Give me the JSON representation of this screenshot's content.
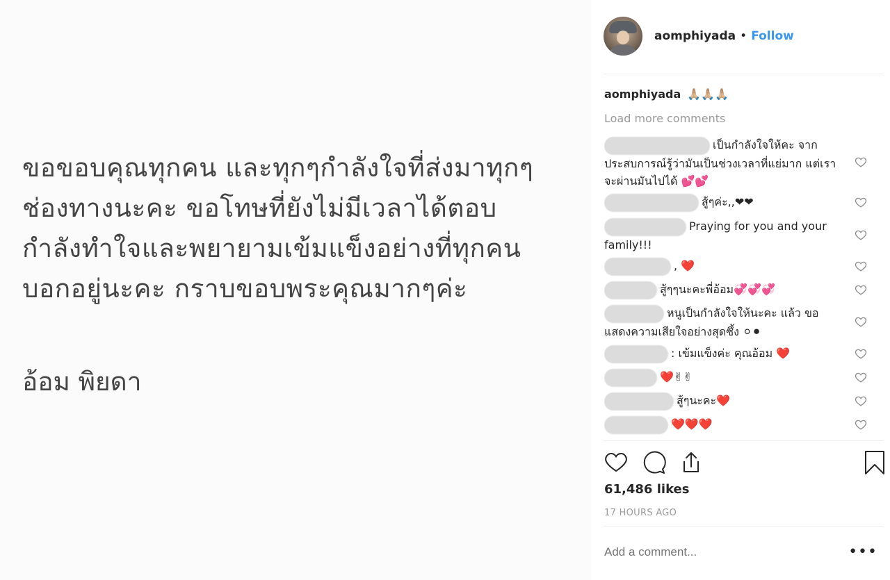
{
  "post": {
    "lines": [
      "ขอขอบคุณทุกคน และทุกๆกำลังใจที่ส่งมาทุกๆ",
      "ช่องทางนะคะ ขอโทษที่ยังไม่มีเวลาได้ตอบ",
      "กำลังทำใจและพยายามเข้มแข็งอย่างที่ทุกคน",
      "บอกอยู่นะคะ กราบขอบพระคุณมากๆค่ะ"
    ],
    "signature": "อ้อม พิยดา"
  },
  "header": {
    "username": "aomphiyada",
    "separator": "•",
    "follow_label": "Follow"
  },
  "caption": {
    "username": "aomphiyada",
    "text": "🙏🏼🙏🏼🙏🏼"
  },
  "load_more": "Load more comments",
  "comments": [
    {
      "text": "เป็นกำลังใจให้คะ จาก ประสบการณ์รู้ว่ามันเป็นช่วงเวลาที่แย่มาก แต่เราจะผ่านมันไปได้ 💕💕"
    },
    {
      "text": "สู้ๆค่ะ,,❤❤"
    },
    {
      "text": "Praying for you and your family!!!"
    },
    {
      "text": ", ❤️"
    },
    {
      "text": "สู้ๆๆนะคะพี่อ้อม💞💞💞"
    },
    {
      "text": "หนูเป็นกำลังใจให้นะคะ แล้ว ขอแสดงความเสียใจอย่างสุดซึ้ง ⚪⚫"
    },
    {
      "text": ": เข้มแข็งค่ะ คุณอ้อม ❤️"
    },
    {
      "text": "❤️✌✌"
    },
    {
      "text": "สู้ๆนะคะ❤️"
    },
    {
      "text": "❤️❤️❤️"
    }
  ],
  "likes": "61,486 likes",
  "time": "17 HOURS AGO",
  "add_comment_placeholder": "Add a comment...",
  "more_label": "•••",
  "colors": {
    "link": "#3897f0",
    "muted": "#999999",
    "text": "#262626"
  },
  "icons": [
    "heart-icon",
    "comment-icon",
    "share-icon",
    "bookmark-icon"
  ]
}
